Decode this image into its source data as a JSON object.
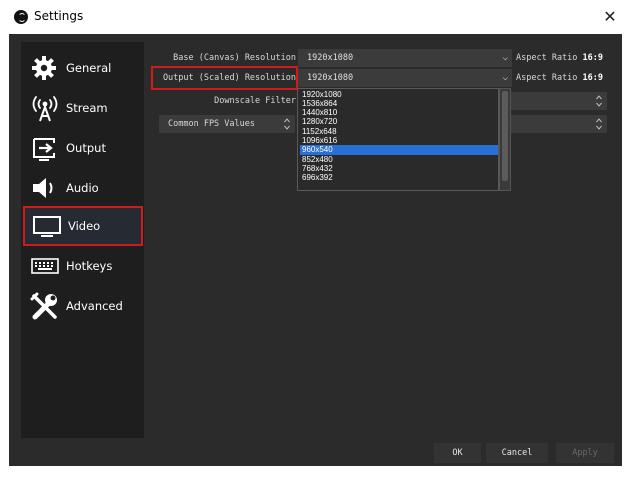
{
  "window": {
    "title": "Settings",
    "close_glyph": "✕"
  },
  "sidebar": {
    "items": [
      {
        "label": "General",
        "icon": "gear-icon"
      },
      {
        "label": "Stream",
        "icon": "antenna-icon"
      },
      {
        "label": "Output",
        "icon": "output-icon"
      },
      {
        "label": "Audio",
        "icon": "speaker-icon"
      },
      {
        "label": "Video",
        "icon": "monitor-icon",
        "selected": true
      },
      {
        "label": "Hotkeys",
        "icon": "keyboard-icon"
      },
      {
        "label": "Advanced",
        "icon": "tools-icon"
      }
    ]
  },
  "video": {
    "base_label": "Base (Canvas) Resolution",
    "base_value": "1920x1080",
    "base_aspect_label": "Aspect Ratio",
    "base_aspect_value": "16:9",
    "output_label": "Output (Scaled) Resolution",
    "output_value": "1920x1080",
    "output_aspect_label": "Aspect Ratio",
    "output_aspect_value": "16:9",
    "downscale_label": "Downscale Filter",
    "fps_label": "Common FPS Values"
  },
  "dropdown": {
    "options": [
      "1920x1080",
      "1536x864",
      "1440x810",
      "1280x720",
      "1152x648",
      "1096x616",
      "960x540",
      "852x480",
      "768x432",
      "696x392"
    ],
    "selected": "960x540"
  },
  "buttons": {
    "ok": "OK",
    "cancel": "Cancel",
    "apply": "Apply"
  },
  "colors": {
    "accent_red": "#d11a1a",
    "selection_blue": "#2a6fd6",
    "panel_bg": "#2b2b2b"
  }
}
